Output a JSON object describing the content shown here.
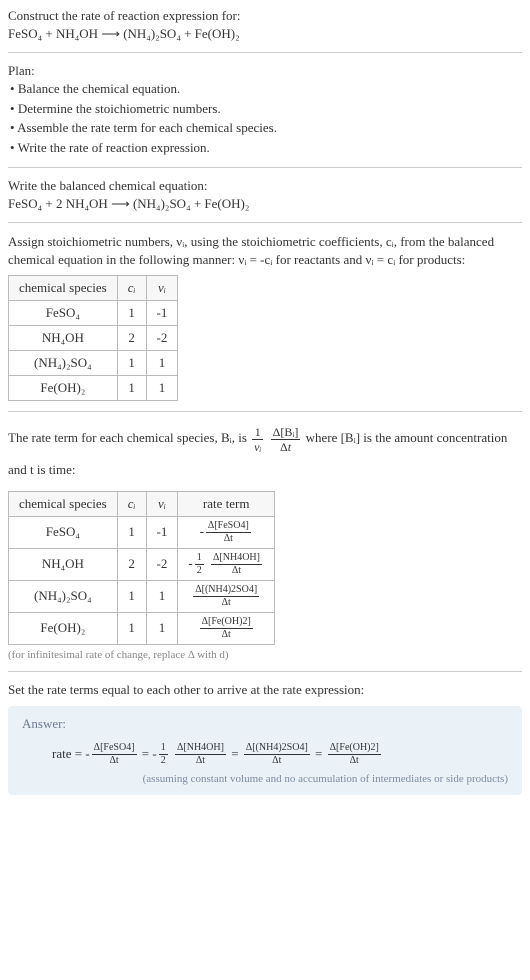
{
  "prompt": {
    "title": "Construct the rate of reaction expression for:",
    "equation": "FeSO₄ + NH₄OH ⟶ (NH₄)₂SO₄ + Fe(OH)₂"
  },
  "plan": {
    "heading": "Plan:",
    "items": [
      "Balance the chemical equation.",
      "Determine the stoichiometric numbers.",
      "Assemble the rate term for each chemical species.",
      "Write the rate of reaction expression."
    ]
  },
  "balanced": {
    "heading": "Write the balanced chemical equation:",
    "equation": "FeSO₄ + 2 NH₄OH ⟶ (NH₄)₂SO₄ + Fe(OH)₂"
  },
  "assign": {
    "text_before": "Assign stoichiometric numbers, νᵢ, using the stoichiometric coefficients, cᵢ, from the balanced chemical equation in the following manner: νᵢ = -cᵢ for reactants and νᵢ = cᵢ for products:",
    "table": {
      "headers": [
        "chemical species",
        "cᵢ",
        "νᵢ"
      ],
      "rows": [
        [
          "FeSO₄",
          "1",
          "-1"
        ],
        [
          "NH₄OH",
          "2",
          "-2"
        ],
        [
          "(NH₄)₂SO₄",
          "1",
          "1"
        ],
        [
          "Fe(OH)₂",
          "1",
          "1"
        ]
      ]
    }
  },
  "rateterm": {
    "text_before": "The rate term for each chemical species, Bᵢ, is ",
    "text_mid": " where [Bᵢ] is the amount concentration and t is time:",
    "table": {
      "headers": [
        "chemical species",
        "cᵢ",
        "νᵢ",
        "rate term"
      ],
      "rows": [
        {
          "sp": "FeSO₄",
          "c": "1",
          "v": "-1",
          "num": "Δ[FeSO4]",
          "den": "Δt",
          "neg": "-",
          "coef": ""
        },
        {
          "sp": "NH₄OH",
          "c": "2",
          "v": "-2",
          "num": "Δ[NH4OH]",
          "den": "Δt",
          "neg": "-",
          "coef": "½"
        },
        {
          "sp": "(NH₄)₂SO₄",
          "c": "1",
          "v": "1",
          "num": "Δ[(NH4)2SO4]",
          "den": "Δt",
          "neg": "",
          "coef": ""
        },
        {
          "sp": "Fe(OH)₂",
          "c": "1",
          "v": "1",
          "num": "Δ[Fe(OH)2]",
          "den": "Δt",
          "neg": "",
          "coef": ""
        }
      ]
    },
    "note": "(for infinitesimal rate of change, replace Δ with d)"
  },
  "final": {
    "text": "Set the rate terms equal to each other to arrive at the rate expression:"
  },
  "answer": {
    "label": "Answer:",
    "prefix": "rate = ",
    "terms": [
      {
        "neg": "-",
        "coef_num": "",
        "coef_den": "",
        "num": "Δ[FeSO4]",
        "den": "Δt"
      },
      {
        "neg": "-",
        "coef_num": "1",
        "coef_den": "2",
        "num": "Δ[NH4OH]",
        "den": "Δt"
      },
      {
        "neg": "",
        "coef_num": "",
        "coef_den": "",
        "num": "Δ[(NH4)2SO4]",
        "den": "Δt"
      },
      {
        "neg": "",
        "coef_num": "",
        "coef_den": "",
        "num": "Δ[Fe(OH)2]",
        "den": "Δt"
      }
    ],
    "note": "(assuming constant volume and no accumulation of intermediates or side products)"
  }
}
